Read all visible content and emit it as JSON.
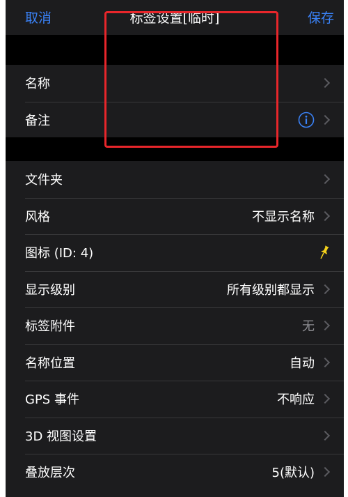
{
  "navbar": {
    "cancel": "取消",
    "title": "标签设置[临时]",
    "save": "保存"
  },
  "group1": [
    {
      "label": "名称"
    },
    {
      "label": "备注",
      "icon": "info-circle-icon"
    }
  ],
  "group2": [
    {
      "label": "文件夹",
      "value": ""
    },
    {
      "label": "风格",
      "value": "不显示名称"
    },
    {
      "label": "图标 (ID: 4)",
      "icon": "pushpin-icon"
    },
    {
      "label": "显示级别",
      "value": "所有级别都显示"
    },
    {
      "label": "标签附件",
      "value": "无"
    },
    {
      "label": "名称位置",
      "value": "自动"
    },
    {
      "label": "GPS 事件",
      "value": "不响应"
    },
    {
      "label": "3D 视图设置",
      "value": ""
    },
    {
      "label": "叠放层次",
      "value": "5(默认)"
    }
  ],
  "colors": {
    "accent": "#3a82f7",
    "highlight": "#e8262b",
    "pin": "#f4d11c"
  }
}
